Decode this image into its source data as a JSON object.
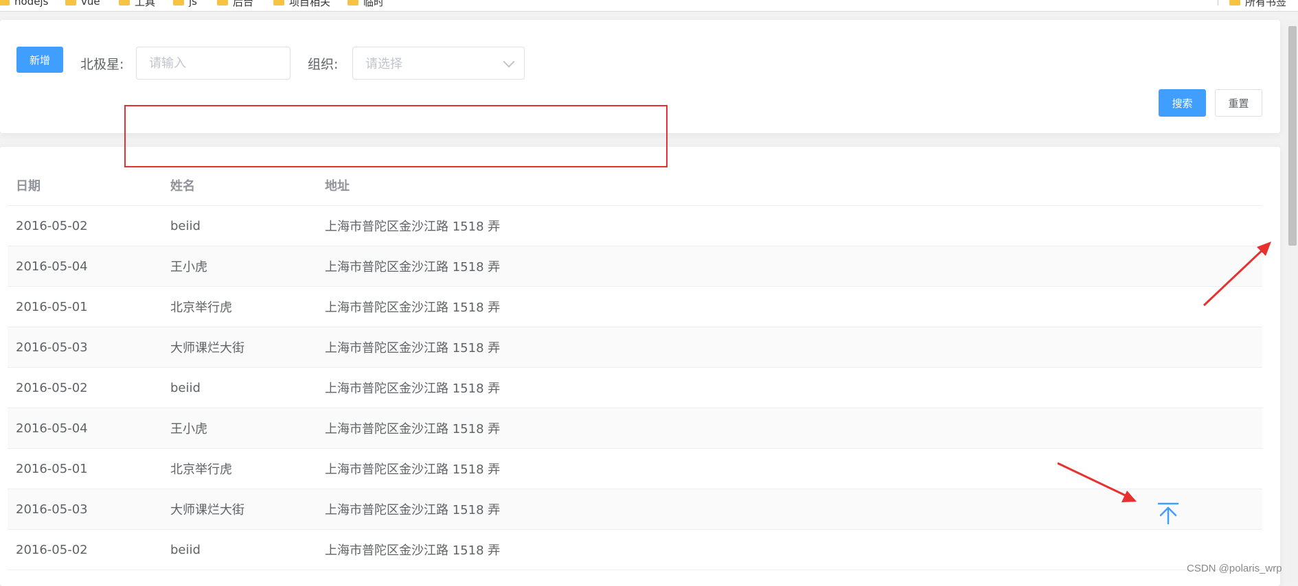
{
  "bookmarks": {
    "items": [
      "nodejs",
      "vue",
      "工具",
      "js",
      "后台",
      "项目相关",
      "临时"
    ],
    "right_item": "所有书签"
  },
  "search": {
    "add_label": "新增",
    "polaris_label": "北极星:",
    "polaris_placeholder": "请输入",
    "org_label": "组织:",
    "org_placeholder": "请选择",
    "search_label": "搜索",
    "reset_label": "重置"
  },
  "table": {
    "columns": [
      "日期",
      "姓名",
      "地址"
    ],
    "rows": [
      {
        "date": "2016-05-02",
        "name": "beiid",
        "address": "上海市普陀区金沙江路 1518 弄"
      },
      {
        "date": "2016-05-04",
        "name": "王小虎",
        "address": "上海市普陀区金沙江路 1518 弄"
      },
      {
        "date": "2016-05-01",
        "name": "北京举行虎",
        "address": "上海市普陀区金沙江路 1518 弄"
      },
      {
        "date": "2016-05-03",
        "name": "大师课烂大街",
        "address": "上海市普陀区金沙江路 1518 弄"
      },
      {
        "date": "2016-05-02",
        "name": "beiid",
        "address": "上海市普陀区金沙江路 1518 弄"
      },
      {
        "date": "2016-05-04",
        "name": "王小虎",
        "address": "上海市普陀区金沙江路 1518 弄"
      },
      {
        "date": "2016-05-01",
        "name": "北京举行虎",
        "address": "上海市普陀区金沙江路 1518 弄"
      },
      {
        "date": "2016-05-03",
        "name": "大师课烂大街",
        "address": "上海市普陀区金沙江路 1518 弄"
      },
      {
        "date": "2016-05-02",
        "name": "beiid",
        "address": "上海市普陀区金沙江路 1518 弄"
      }
    ]
  },
  "back_to_top_icon": "arrow-up-to-line-icon",
  "colors": {
    "primary": "#409eff",
    "annotation": "#e8302f"
  },
  "watermark": "CSDN @polaris_wrp"
}
